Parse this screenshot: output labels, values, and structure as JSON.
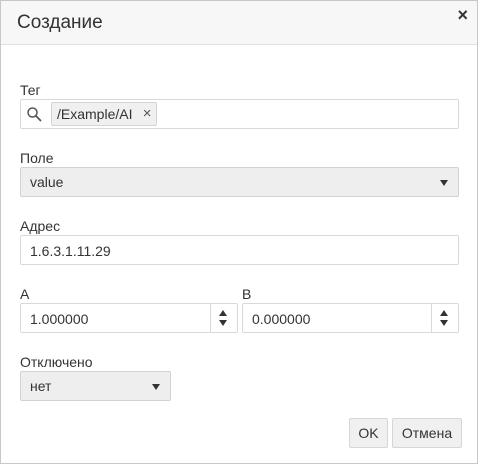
{
  "dialog": {
    "title": "Создание",
    "close_symbol": "×"
  },
  "tag": {
    "label": "Тег",
    "icon": "search-icon",
    "chips": [
      {
        "text": "/Example/AI",
        "remove_symbol": "×"
      }
    ]
  },
  "field": {
    "label": "Поле",
    "selected": "value"
  },
  "address": {
    "label": "Адрес",
    "value": "1.6.3.1.11.29"
  },
  "a": {
    "label": "А",
    "value": "1.000000"
  },
  "b": {
    "label": "В",
    "value": "0.000000"
  },
  "disabled": {
    "label": "Отключено",
    "selected": "нет"
  },
  "buttons": {
    "ok": "OK",
    "cancel": "Отмена"
  }
}
